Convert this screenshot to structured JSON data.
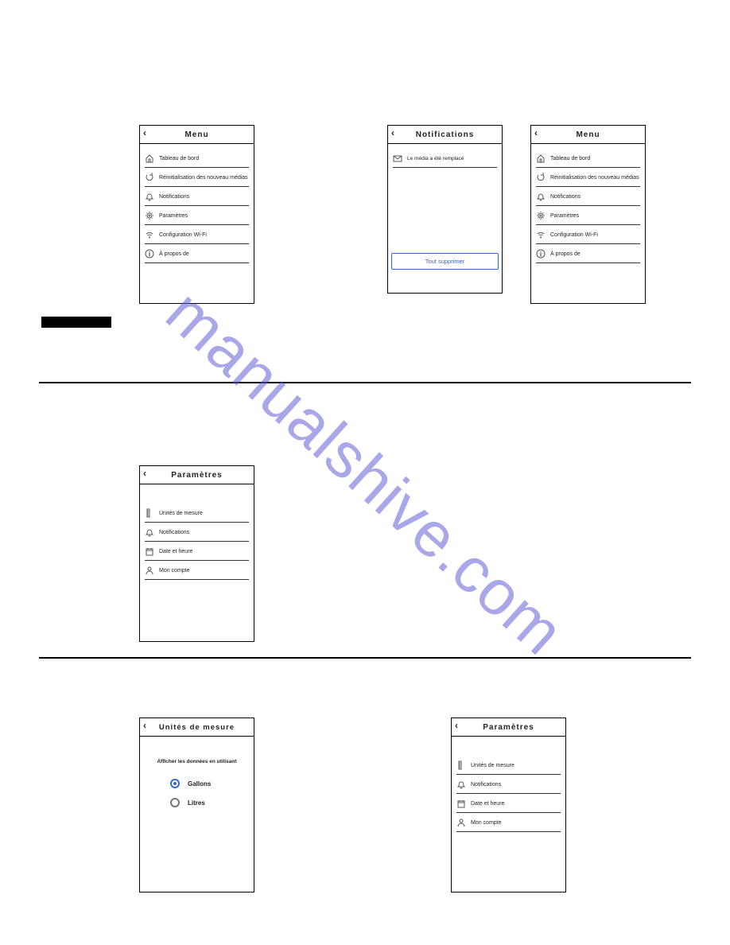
{
  "watermark": "manualshive.com",
  "screens": {
    "menu1": {
      "title": "Menu",
      "items": [
        "Tableau de bord",
        "Réinitialisation des nouveau médias",
        "Notifications",
        "Paramètres",
        "Configuration Wi-Fi",
        "À propos de"
      ]
    },
    "notifications": {
      "title": "Notifications",
      "message": "Le média a été remplacé",
      "clear_all": "Tout supprimer"
    },
    "menu2": {
      "title": "Menu",
      "items": [
        "Tableau de bord",
        "Réinitialisation des nouveau médias",
        "Notifications",
        "Paramètres",
        "Configuration Wi-Fi",
        "À propos de"
      ]
    },
    "settings1": {
      "title": "Paramètres",
      "items": [
        "Unités de mesure",
        "Notifications",
        "Date et heure",
        "Mon compte"
      ]
    },
    "units": {
      "title": "Unités de mesure",
      "intro": "Afficher les données en utilisant",
      "options": [
        "Gallons",
        "Litres"
      ],
      "selected": "Gallons"
    },
    "settings2": {
      "title": "Paramètres",
      "items": [
        "Unités de mesure",
        "Notifications",
        "Date et heure",
        "Mon compte"
      ]
    }
  }
}
